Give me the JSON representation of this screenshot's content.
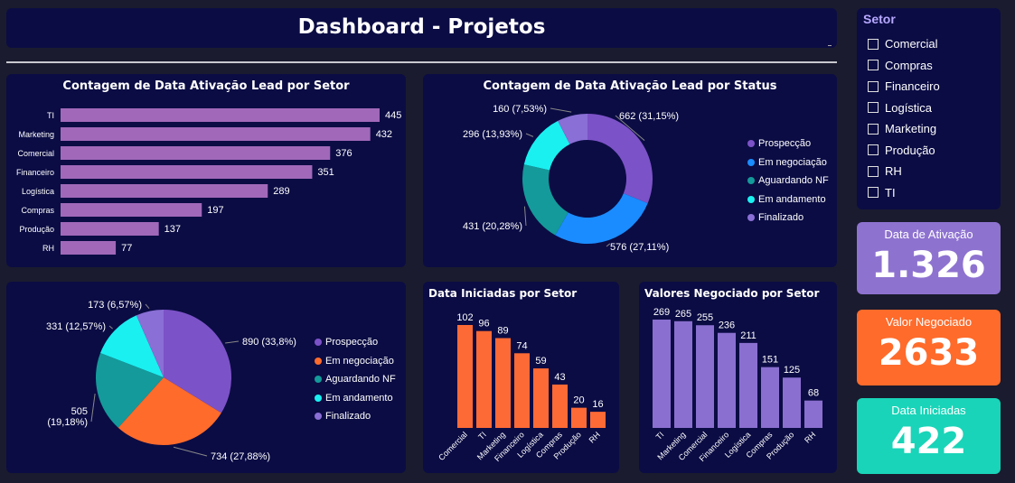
{
  "header": {
    "title": "Dashboard - Projetos"
  },
  "setor_filter": {
    "title": "Setor",
    "items": [
      "Comercial",
      "Compras",
      "Financeiro",
      "Logística",
      "Marketing",
      "Produção",
      "RH",
      "TI"
    ]
  },
  "kpis": [
    {
      "label": "Data de Ativação",
      "value": "1.326",
      "color": "#8e72d0"
    },
    {
      "label": "Valor Negociado",
      "value": "2633",
      "color": "#ff6b2b"
    },
    {
      "label": "Data Iniciadas",
      "value": "422",
      "color": "#19d4b8"
    }
  ],
  "colors": {
    "card": "#0b0c44",
    "bar_purple": "#a168b9",
    "bar_orange": "#fe6a35",
    "bar_lavender": "#8a6fd0",
    "Prospecção": "#7c52c8",
    "Em negociação": "#1a8cff",
    "Aguardando NF": "#149a9a",
    "Em andamento": "#1af0f0",
    "Finalizado": "#8a6fd6",
    "pie_Em negociação": "#ff6b2b"
  },
  "chart_data": [
    {
      "type": "bar",
      "orientation": "horizontal",
      "title": "Contagem de Data Ativação Lead por Setor",
      "categories": [
        "TI",
        "Marketing",
        "Comercial",
        "Financeiro",
        "Logística",
        "Compras",
        "Produção",
        "RH"
      ],
      "values": [
        445,
        432,
        376,
        351,
        289,
        197,
        137,
        77
      ]
    },
    {
      "type": "pie",
      "variant": "donut",
      "title": "Contagem de Data Ativação Lead por Status",
      "categories": [
        "Prospecção",
        "Em negociação",
        "Aguardando NF",
        "Em andamento",
        "Finalizado"
      ],
      "values": [
        662,
        576,
        431,
        296,
        160
      ],
      "labels": [
        "662 (31,15%)",
        "576 (27,11%)",
        "431 (20,28%)",
        "296 (13,93%)",
        "160 (7,53%)"
      ]
    },
    {
      "type": "pie",
      "title": "",
      "categories": [
        "Prospecção",
        "Em negociação",
        "Aguardando NF",
        "Em andamento",
        "Finalizado"
      ],
      "values": [
        890,
        734,
        505,
        331,
        173
      ],
      "labels": [
        "890 (33,8%)",
        "734 (27,88%)",
        "505 (19,18%)",
        "331 (12,57%)",
        "173 (6,57%)"
      ]
    },
    {
      "type": "bar",
      "title": "Data Iniciadas por Setor",
      "categories": [
        "Comercial",
        "TI",
        "Marketing",
        "Financeiro",
        "Logística",
        "Compras",
        "Produção",
        "RH"
      ],
      "values": [
        102,
        96,
        89,
        74,
        59,
        43,
        20,
        16
      ]
    },
    {
      "type": "bar",
      "title": "Valores Negociado por Setor",
      "categories": [
        "TI",
        "Marketing",
        "Comercial",
        "Financeiro",
        "Logística",
        "Compras",
        "Produção",
        "RH"
      ],
      "values": [
        269,
        265,
        255,
        236,
        211,
        151,
        125,
        68
      ]
    }
  ]
}
